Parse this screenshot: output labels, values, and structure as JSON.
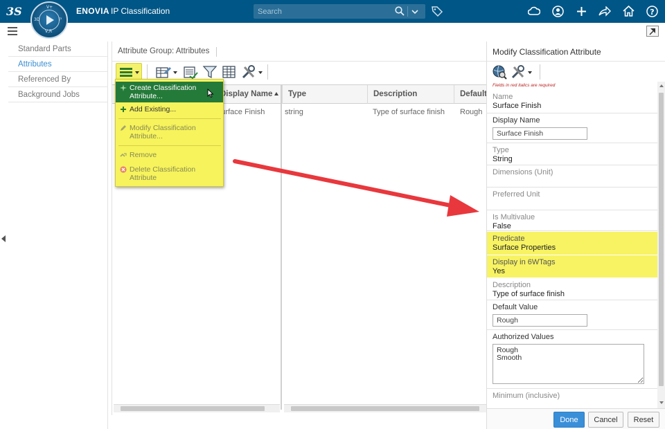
{
  "topbar": {
    "brand": "ENOVIA",
    "app_name": "IP Classification",
    "search_placeholder": "Search",
    "compass": {
      "north": "V+",
      "west": "3D",
      "east": "i³",
      "south": "V,R"
    }
  },
  "colors": {
    "topbar": "#005686",
    "highlight_yellow": "#f6f35c",
    "menu_active_green": "#247a39",
    "primary_blue": "#3a8fd9",
    "arrow_red": "#e8383d"
  },
  "icons": {
    "top_right": [
      "cloud-icon",
      "user-icon",
      "plus-icon",
      "share-icon",
      "home-icon",
      "help-icon"
    ]
  },
  "leftnav": {
    "items": [
      {
        "label": "Standard Parts",
        "active": false
      },
      {
        "label": "Attributes",
        "active": true
      },
      {
        "label": "Referenced By",
        "active": false
      },
      {
        "label": "Background Jobs",
        "active": false
      }
    ]
  },
  "middle": {
    "title": "Attribute Group: Attributes",
    "columns": [
      {
        "label": "Display Name",
        "sorted": "asc"
      },
      {
        "label": "Type"
      },
      {
        "label": "Description"
      },
      {
        "label": "Default"
      }
    ],
    "row": {
      "display_name": "Surface Finish",
      "type": "string",
      "description": "Type of surface finish",
      "default": "Rough"
    }
  },
  "dropdown": {
    "items": [
      {
        "label_line1": "Create Classification",
        "label_line2": "Attribute...",
        "state": "hover"
      },
      {
        "label_line1": "Add Existing...",
        "state": "enabled"
      },
      {
        "label_line1": "Modify Classification",
        "label_line2": "Attribute...",
        "state": "disabled"
      },
      {
        "label_line1": "Remove",
        "state": "disabled"
      },
      {
        "label_line1": "Delete Classification",
        "label_line2": "Attribute",
        "state": "disabled"
      }
    ]
  },
  "right": {
    "title": "Modify Classification Attribute",
    "required_note": "Fields in red italics are required",
    "fields": {
      "name": {
        "label": "Name",
        "value": "Surface Finish"
      },
      "display_name": {
        "label": "Display Name",
        "value": "Surface Finish"
      },
      "type": {
        "label": "Type",
        "value": "String"
      },
      "dimensions": {
        "label": "Dimensions (Unit)",
        "value": ""
      },
      "preferred_unit": {
        "label": "Preferred Unit",
        "value": ""
      },
      "multivalue": {
        "label": "Is Multivalue",
        "value": "False"
      },
      "predicate": {
        "label": "Predicate",
        "value": "Surface Properties"
      },
      "display_6w": {
        "label": "Display in 6WTags",
        "value": "Yes"
      },
      "description": {
        "label": "Description",
        "value": "Type of surface finish"
      },
      "default_value": {
        "label": "Default Value",
        "value": "Rough"
      },
      "authorized_values": {
        "label": "Authorized Values",
        "value": "Rough\nSmooth"
      },
      "minimum": {
        "label": "Minimum (inclusive)",
        "value": ""
      }
    },
    "buttons": {
      "done": "Done",
      "cancel": "Cancel",
      "reset": "Reset"
    }
  }
}
